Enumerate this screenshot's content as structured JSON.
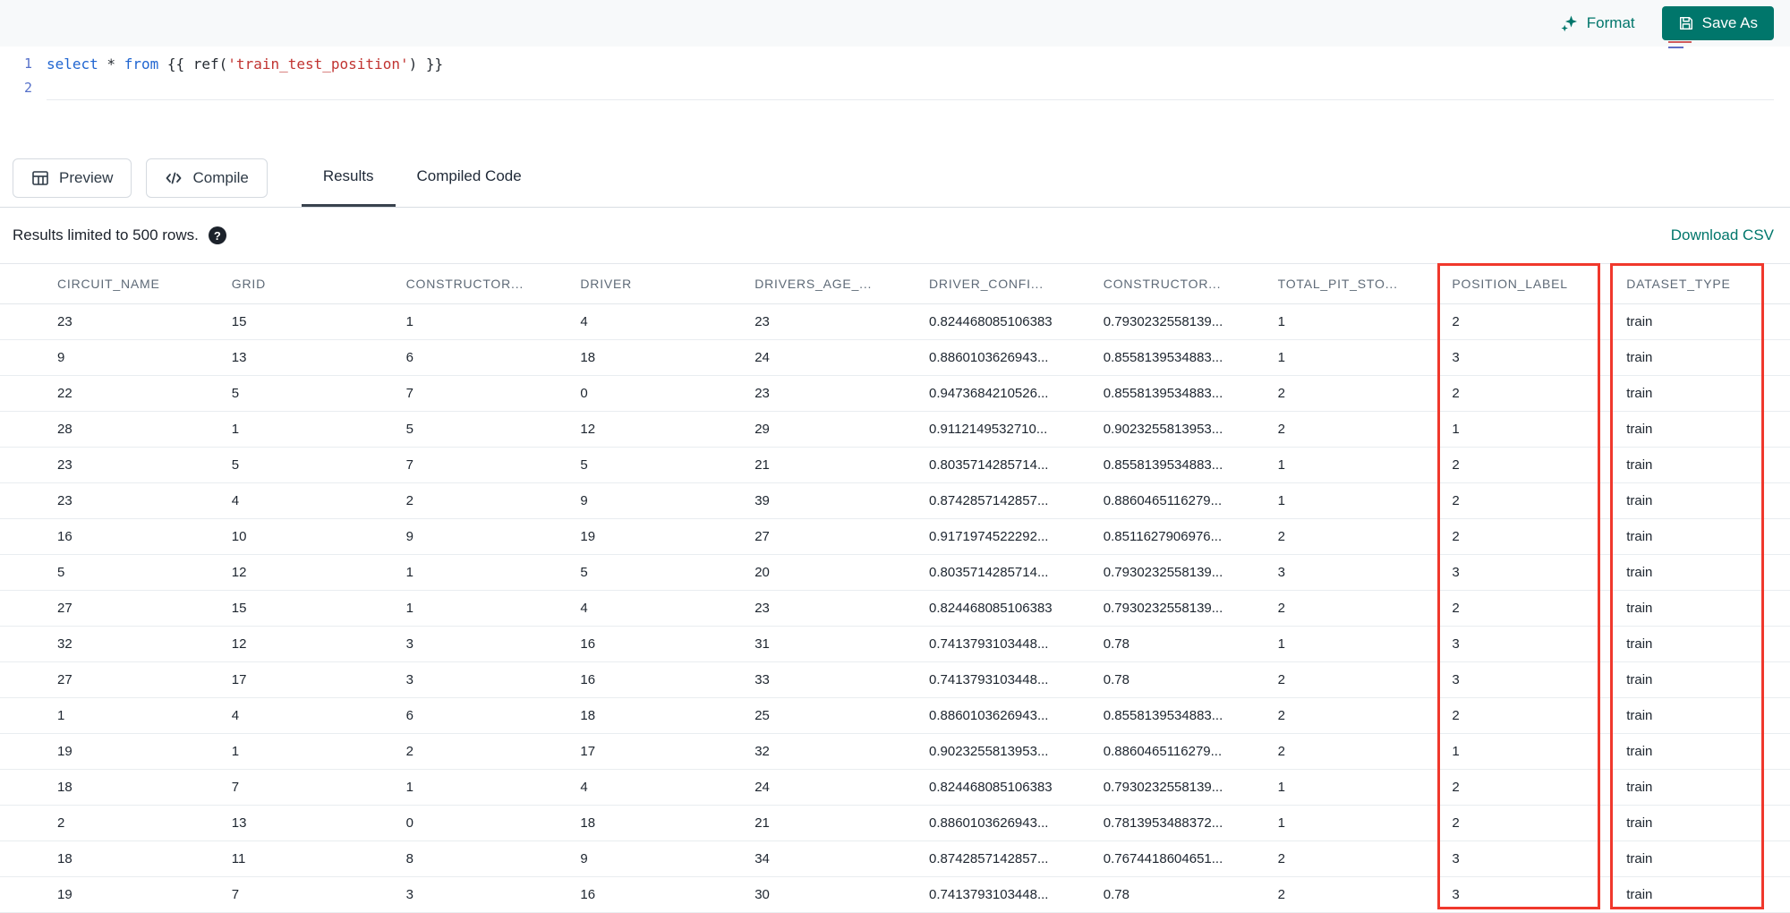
{
  "topbar": {
    "format_label": "Format",
    "save_as_label": "Save As"
  },
  "editor": {
    "line_numbers": [
      "1",
      "2"
    ],
    "code_tokens": [
      {
        "text": "select",
        "type": "keyword"
      },
      {
        "text": " * ",
        "type": "plain"
      },
      {
        "text": "from",
        "type": "keyword"
      },
      {
        "text": " {{ ",
        "type": "plain"
      },
      {
        "text": "ref(",
        "type": "function"
      },
      {
        "text": "'train_test_position'",
        "type": "string"
      },
      {
        "text": ") }}",
        "type": "plain"
      }
    ]
  },
  "toolbar": {
    "preview_label": "Preview",
    "compile_label": "Compile",
    "tabs": [
      {
        "label": "Results",
        "active": true
      },
      {
        "label": "Compiled Code",
        "active": false
      }
    ]
  },
  "results_bar": {
    "limit_text": "Results limited to 500 rows.",
    "help_icon": "?",
    "download_label": "Download CSV"
  },
  "table": {
    "columns": [
      "CIRCUIT_NAME",
      "GRID",
      "CONSTRUCTOR...",
      "DRIVER",
      "DRIVERS_AGE_...",
      "DRIVER_CONFI...",
      "CONSTRUCTOR...",
      "TOTAL_PIT_STO...",
      "POSITION_LABEL",
      "DATASET_TYPE"
    ],
    "rows": [
      [
        "23",
        "15",
        "1",
        "4",
        "23",
        "0.824468085106383",
        "0.7930232558139...",
        "1",
        "2",
        "train"
      ],
      [
        "9",
        "13",
        "6",
        "18",
        "24",
        "0.8860103626943...",
        "0.8558139534883...",
        "1",
        "3",
        "train"
      ],
      [
        "22",
        "5",
        "7",
        "0",
        "23",
        "0.9473684210526...",
        "0.8558139534883...",
        "2",
        "2",
        "train"
      ],
      [
        "28",
        "1",
        "5",
        "12",
        "29",
        "0.9112149532710...",
        "0.9023255813953...",
        "2",
        "1",
        "train"
      ],
      [
        "23",
        "5",
        "7",
        "5",
        "21",
        "0.8035714285714...",
        "0.8558139534883...",
        "1",
        "2",
        "train"
      ],
      [
        "23",
        "4",
        "2",
        "9",
        "39",
        "0.8742857142857...",
        "0.8860465116279...",
        "1",
        "2",
        "train"
      ],
      [
        "16",
        "10",
        "9",
        "19",
        "27",
        "0.9171974522292...",
        "0.8511627906976...",
        "2",
        "2",
        "train"
      ],
      [
        "5",
        "12",
        "1",
        "5",
        "20",
        "0.8035714285714...",
        "0.7930232558139...",
        "3",
        "3",
        "train"
      ],
      [
        "27",
        "15",
        "1",
        "4",
        "23",
        "0.824468085106383",
        "0.7930232558139...",
        "2",
        "2",
        "train"
      ],
      [
        "32",
        "12",
        "3",
        "16",
        "31",
        "0.7413793103448...",
        "0.78",
        "1",
        "3",
        "train"
      ],
      [
        "27",
        "17",
        "3",
        "16",
        "33",
        "0.7413793103448...",
        "0.78",
        "2",
        "3",
        "train"
      ],
      [
        "1",
        "4",
        "6",
        "18",
        "25",
        "0.8860103626943...",
        "0.8558139534883...",
        "2",
        "2",
        "train"
      ],
      [
        "19",
        "1",
        "2",
        "17",
        "32",
        "0.9023255813953...",
        "0.8860465116279...",
        "2",
        "1",
        "train"
      ],
      [
        "18",
        "7",
        "1",
        "4",
        "24",
        "0.824468085106383",
        "0.7930232558139...",
        "1",
        "2",
        "train"
      ],
      [
        "2",
        "13",
        "0",
        "18",
        "21",
        "0.8860103626943...",
        "0.7813953488372...",
        "1",
        "2",
        "train"
      ],
      [
        "18",
        "11",
        "8",
        "9",
        "34",
        "0.8742857142857...",
        "0.7674418604651...",
        "2",
        "3",
        "train"
      ],
      [
        "19",
        "7",
        "3",
        "16",
        "30",
        "0.7413793103448...",
        "0.78",
        "2",
        "3",
        "train"
      ]
    ],
    "highlighted_columns": [
      "POSITION_LABEL",
      "DATASET_TYPE"
    ],
    "highlight_color": "#f0382c"
  },
  "colors": {
    "accent_teal": "#00766b",
    "keyword_blue": "#2166d1",
    "string_red": "#c13431"
  }
}
